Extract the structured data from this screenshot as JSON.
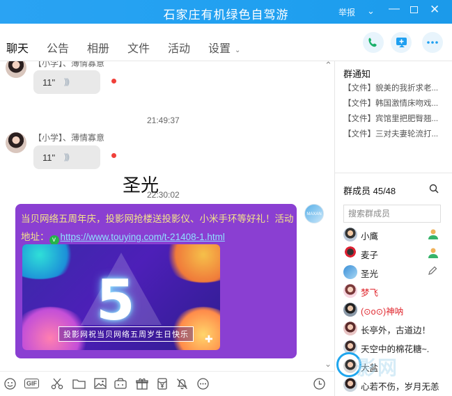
{
  "window": {
    "title": "石家庄有机绿色自驾游",
    "report_label": "举报"
  },
  "tabs": [
    {
      "label": "聊天",
      "active": true
    },
    {
      "label": "公告"
    },
    {
      "label": "相册"
    },
    {
      "label": "文件"
    },
    {
      "label": "活动"
    },
    {
      "label": "设置"
    }
  ],
  "header_actions": [
    "phone-icon",
    "share-screen-icon",
    "more-icon"
  ],
  "chat": {
    "messages": [
      {
        "sender": "【小学】、薄情寡意",
        "type": "voice",
        "duration": "11\"",
        "unread": true
      },
      {
        "timestamp": "21:49:37"
      },
      {
        "sender": "【小学】、薄情寡意",
        "type": "voice",
        "duration": "11\"",
        "unread": true
      },
      {
        "big_text": "圣光"
      },
      {
        "timestamp": "22:30:02"
      },
      {
        "type": "promo",
        "text": "当贝网络五周年庆，投影网抢楼送投影仪、小米手环等好礼！活动地址：",
        "link": "https://www.touying.com/t-21408-1.html",
        "image_caption": "投影网祝当贝网络五周岁生日快乐",
        "image_big": "5"
      }
    ],
    "self_avatar_text": "MAXAN"
  },
  "toolbar_icons": [
    "emoji-icon",
    "gif-icon",
    "scissors-icon",
    "folder-icon",
    "image-icon",
    "screenshot-icon",
    "gift-icon",
    "red-packet-icon",
    "bell-icon",
    "more-icon",
    "history-icon"
  ],
  "toolbar_gif_label": "GIF",
  "notice": {
    "title": "群通知",
    "items": [
      "【文件】貌美的我折求老...",
      "【文件】韩国激情床吻戏...",
      "【文件】宾馆里把肥臀翘...",
      "【文件】三对夫妻轮流打..."
    ]
  },
  "members": {
    "title": "群成员 45/48",
    "search_placeholder": "搜索群成员",
    "list": [
      {
        "name": "小鹰",
        "badge": "admin-green",
        "red": false
      },
      {
        "name": "麦子",
        "badge": "admin-green",
        "red": false
      },
      {
        "name": "圣光",
        "badge": "edit-icon",
        "red": false
      },
      {
        "name": "梦飞",
        "badge": "",
        "red": true
      },
      {
        "name": "(⊙o⊙)神呐",
        "badge": "",
        "red": true
      },
      {
        "name": "长亭外，古道边！",
        "badge": "",
        "red": false
      },
      {
        "name": "天空中的棉花糖~.",
        "badge": "",
        "red": false
      },
      {
        "name": "大盐",
        "badge": "",
        "red": false
      },
      {
        "name": "心若不伤，岁月无恙",
        "badge": "",
        "red": false
      }
    ]
  },
  "watermark": "影网",
  "colors": {
    "title_bar": "#1e9ff0",
    "promo_bubble": "#8a3fd2",
    "promo_text": "#f3e38a",
    "unread_dot": "#f0403a",
    "member_red": "#e0282f"
  }
}
